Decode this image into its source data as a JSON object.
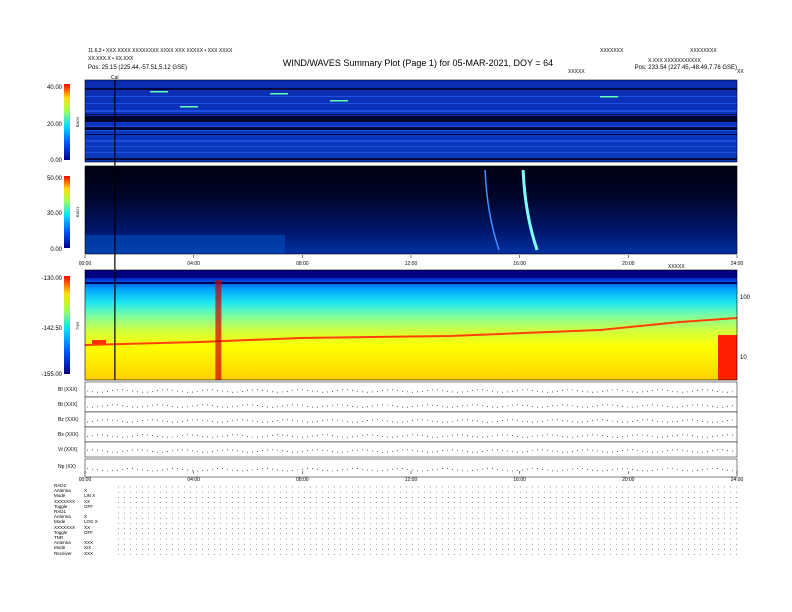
{
  "header": {
    "title": "WIND/WAVES Summary Plot (Page 1) for 05-MAR-2021, DOY = 64",
    "top_left_1": "11.6.3 • XXX XXXX XXXXXXXX XXXX XXX XXXXX • XXX XXXX",
    "top_left_2": "XX.XXX.X • XX.XXX",
    "top_right_1": "XXXXXXX",
    "top_right_2": "XXXXXXXX",
    "top_right_3": "X.XXX XXXXXXXXXXX",
    "pos_left": "Pos: 25.15 (225.44,-57.51,5.12 GSE)",
    "pos_right": "Pos: 233.54 (227.45,-48.49,7.76 GSE)",
    "scale_label": "XXXXX",
    "cal_label": "Cal",
    "end_label": "XX"
  },
  "panels": {
    "rad2": {
      "label": "RAD2",
      "ticks": [
        "40.00",
        "20.00",
        "0.00"
      ]
    },
    "rad1": {
      "label": "RAD1",
      "ticks": [
        "50.00",
        "30.00",
        "0.00"
      ]
    },
    "tnr": {
      "label": "TNR",
      "ticks": [
        "-130.00",
        "-142.50",
        "-155.00"
      ],
      "right_ticks": [
        "100",
        "10"
      ],
      "right_unit": "XXXXX"
    },
    "hk_labels": [
      "BI (XXX)",
      "Bt (XXX)",
      "Bz (XXX)",
      "Bx (XXX)",
      "Vt (XXX)",
      "Np (XX)"
    ]
  },
  "chart_data": {
    "type": "heatmap",
    "title": "WIND/WAVES Summary Plot (Page 1) for 05-MAR-2021, DOY = 64",
    "x_ticks": [
      "00:00",
      "04:00",
      "08:00",
      "12:00",
      "16:00",
      "20:00",
      "24:00"
    ],
    "xlim": [
      0,
      24
    ],
    "burst_hours": [
      14.8,
      16.2
    ],
    "cal_hour": 1.1,
    "colors": {
      "low": "#00007f",
      "mid": "#00c8ff",
      "high": "#ffff00",
      "max": "#ff0000"
    }
  },
  "footer": {
    "rows": [
      [
        "RAD2",
        ""
      ],
      [
        "Antenna",
        "X"
      ],
      [
        "Mode",
        "LIN X"
      ],
      [
        "XXXXXXX",
        "XX"
      ],
      [
        "Toggle",
        "OFF"
      ],
      [
        "RAD1",
        ""
      ],
      [
        "Antenna",
        "X"
      ],
      [
        "Mode",
        "LOG X"
      ],
      [
        "XXXXXXX",
        "XX"
      ],
      [
        "Toggle",
        "OFF"
      ],
      [
        "TNR",
        ""
      ],
      [
        "Antenna",
        "XXX"
      ],
      [
        "Mode",
        "X/X"
      ],
      [
        "Receiver",
        "XXX"
      ]
    ]
  }
}
